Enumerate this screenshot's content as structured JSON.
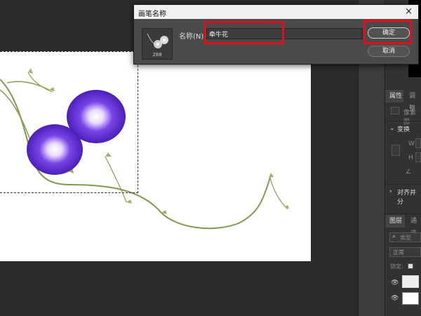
{
  "dialog": {
    "title": "画笔名称",
    "close_glyph": "×",
    "brush_size": "288",
    "name_label": "名称(N):",
    "name_value": "牵牛花",
    "ok_label": "确定",
    "cancel_label": "取消"
  },
  "panel": {
    "tab_properties": "属性",
    "tab_adjust": "调整",
    "pixel_layer": "像素图",
    "transform_title": "变换",
    "w_label": "W",
    "h_label": "H",
    "align_title": "对齐并分",
    "tab_layers": "图层",
    "tab_channels": "通道",
    "search_placeholder": "类型",
    "blend_mode": "正常",
    "lock_label": "锁定:"
  },
  "colors": {
    "highlight": "#e0101a",
    "flower": "#5b2bd6",
    "stem": "#7f9a4e"
  }
}
